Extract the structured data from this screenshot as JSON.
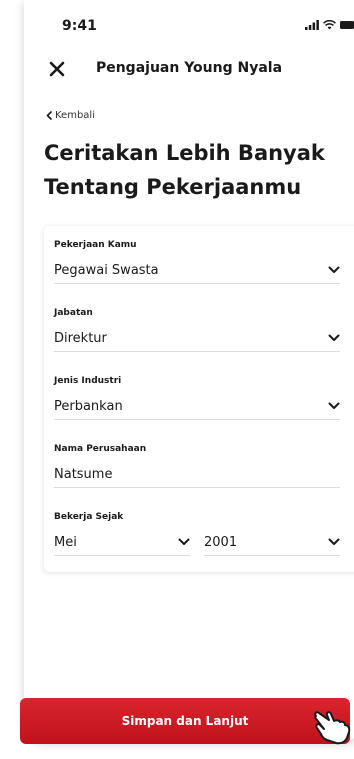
{
  "status_bar": {
    "time": "9:41"
  },
  "header": {
    "title": "Pengajuan Young Nyala",
    "close_icon": "close-icon"
  },
  "back_link": {
    "label": "Kembali"
  },
  "page": {
    "title": "Ceritakan Lebih Banyak Tentang Pekerjaanmu"
  },
  "form": {
    "pekerjaan": {
      "label": "Pekerjaan Kamu",
      "value": "Pegawai Swasta"
    },
    "jabatan": {
      "label": "Jabatan",
      "value": "Direktur"
    },
    "industri": {
      "label": "Jenis Industri",
      "value": "Perbankan"
    },
    "perusahaan": {
      "label": "Nama Perusahaan",
      "value": "Natsume"
    },
    "sejak": {
      "label": "Bekerja Sejak",
      "month": "Mei",
      "year": "2001"
    }
  },
  "submit": {
    "label": "Simpan dan Lanjut"
  },
  "colors": {
    "accent": "#c8161f",
    "text": "#1a1a1a",
    "divider": "#d9d9d9"
  }
}
